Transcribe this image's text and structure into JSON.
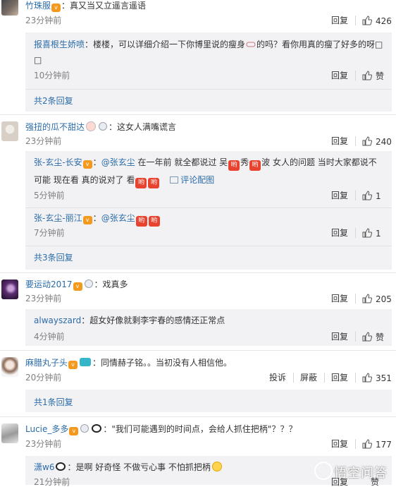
{
  "c1": {
    "user": "竹珠服",
    "text": "：真又当又立遥言遥语",
    "time": "23分钟前",
    "reply": "回复",
    "likes": "426",
    "sub": {
      "user": "报喜根生娇喷",
      "text": "：楼楼，可以详细介绍一下你博里说的瘦身",
      "text2": "的吗？看你用真的瘦了好多的呀",
      "box_char": "□",
      "time": "10分钟前",
      "reply": "回复",
      "like": "赞",
      "more": "共2条回复"
    }
  },
  "c2": {
    "user": "强扭的瓜不甜达",
    "text": "：这女人满嘴谎言",
    "time": "23分钟前",
    "reply": "回复",
    "likes": "240",
    "sub1": {
      "user": "张-玄尘-长安",
      "mention": "@张玄尘",
      "t1": " 在一年前 就全都说过 吴",
      "t2": "秀",
      "t3": "波 女人的问题 当时大家都说不",
      "line2": "可能 现在看 真的说对了 看",
      "pic": "评论配图",
      "time": "5分钟前",
      "reply": "回复",
      "likes": "1"
    },
    "sub2": {
      "user": "张-玄尘-丽江",
      "mention": "@张玄尘",
      "time": "7分钟前",
      "reply": "回复",
      "likes": "1"
    },
    "more": "共3条回复"
  },
  "c3": {
    "user": "要运动2017",
    "text": "：戏真多",
    "time": "23分钟前",
    "reply": "回复",
    "likes": "205",
    "sub": {
      "user": "alwayszard",
      "text": "：超女好像就剩李宇春的感情还正常点",
      "time": "4分钟前",
      "reply": "回复",
      "like": "赞"
    }
  },
  "c4": {
    "user": "麻腊丸子头",
    "text": "：同情赫子铭。。当初没有人相信他。",
    "time": "20分钟前",
    "report": "投诉",
    "block": "屏蔽",
    "reply": "回复",
    "likes": "351",
    "more": "共1条回复"
  },
  "c5": {
    "user": "Lucie_多多",
    "text": "：\"我们可能遇到的时间点，会给人抓住把柄\"？？？",
    "time": "23分钟前",
    "reply": "回复",
    "likes": "177",
    "sub": {
      "user": "潇w6",
      "text": "：是啊 好奇怪 不做亏心事 不怕抓把柄",
      "time": "21分钟前",
      "reply": "回复",
      "like": "赞"
    }
  },
  "badge_char": "v",
  "hand_char": "哟",
  "watermark": "悟空问答",
  "colors": {
    "link": "#2b6ca8",
    "badge": "#f39a1e",
    "hand_emoji": "#e8432f",
    "sub_bg": "#f2f2f5",
    "time": "#808080"
  }
}
